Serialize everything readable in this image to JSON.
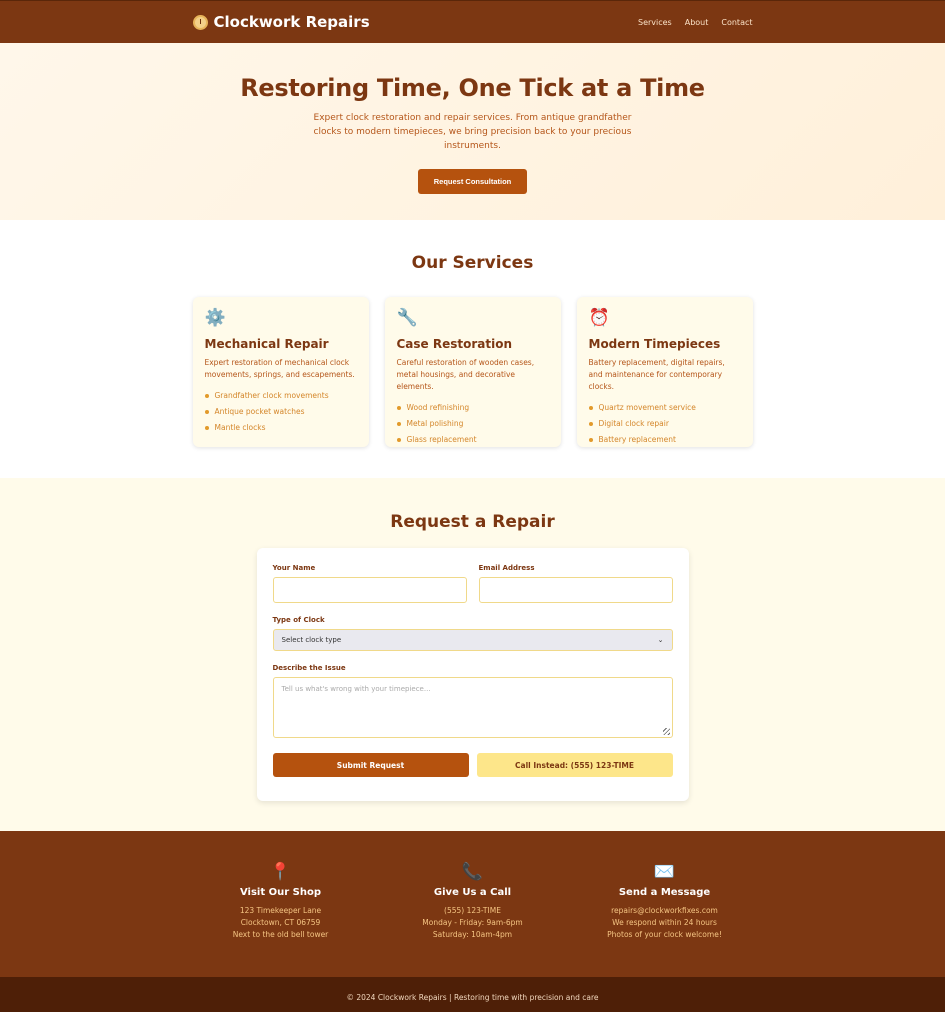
{
  "header": {
    "brand": "Clockwork Repairs",
    "nav": [
      "Services",
      "About",
      "Contact"
    ]
  },
  "hero": {
    "title": "Restoring Time, One Tick at a Time",
    "subtitle": "Expert clock restoration and repair services. From antique grandfather clocks to modern timepieces, we bring precision back to your precious instruments.",
    "button": "Request Consultation"
  },
  "services": {
    "title": "Our Services",
    "cards": [
      {
        "icon": "⚙️",
        "title": "Mechanical Repair",
        "desc": "Expert restoration of mechanical clock movements, springs, and escapements.",
        "items": [
          "Grandfather clock movements",
          "Antique pocket watches",
          "Mantle clocks"
        ]
      },
      {
        "icon": "🔧",
        "title": "Case Restoration",
        "desc": "Careful restoration of wooden cases, metal housings, and decorative elements.",
        "items": [
          "Wood refinishing",
          "Metal polishing",
          "Glass replacement"
        ]
      },
      {
        "icon": "⏰",
        "title": "Modern Timepieces",
        "desc": "Battery replacement, digital repairs, and maintenance for contemporary clocks.",
        "items": [
          "Quartz movement service",
          "Digital clock repair",
          "Battery replacement"
        ]
      }
    ]
  },
  "request": {
    "title": "Request a Repair",
    "name_label": "Your Name",
    "email_label": "Email Address",
    "clock_label": "Type of Clock",
    "clock_selected": "Select clock type",
    "issue_label": "Describe the Issue",
    "issue_placeholder": "Tell us what's wrong with your timepiece...",
    "submit": "Submit Request",
    "call": "Call Instead: (555) 123-TIME"
  },
  "footer": {
    "cols": [
      {
        "icon": "📍",
        "title": "Visit Our Shop",
        "lines": [
          "123 Timekeeper Lane",
          "Clocktown, CT 06759",
          "Next to the old bell tower"
        ]
      },
      {
        "icon": "📞",
        "title": "Give Us a Call",
        "lines": [
          "(555) 123-TIME",
          "Monday - Friday: 9am-6pm",
          "Saturday: 10am-4pm"
        ]
      },
      {
        "icon": "✉️",
        "title": "Send a Message",
        "lines": [
          "repairs@clockworkfixes.com",
          "We respond within 24 hours",
          "Photos of your clock welcome!"
        ]
      }
    ],
    "copyright": "© 2024 Clockwork Repairs | Restoring time with precision and care"
  },
  "colors": {
    "brand_brown": "#7c3712",
    "accent_orange": "#b5520e",
    "cream": "#fffbea",
    "yellow_button": "#fde68a"
  }
}
